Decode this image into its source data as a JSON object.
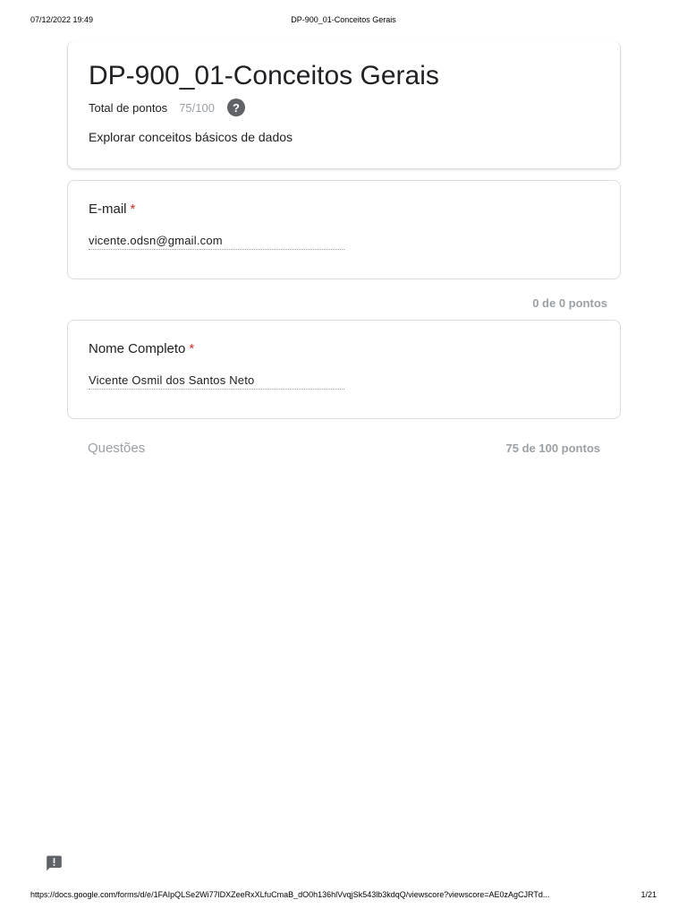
{
  "print_header": {
    "date": "07/12/2022 19:49",
    "title": "DP-900_01-Conceitos Gerais"
  },
  "form": {
    "title": "DP-900_01-Conceitos Gerais",
    "points_label": "Total de pontos",
    "points_value": "75/100",
    "help_icon_glyph": "?",
    "description": "Explorar conceitos básicos de dados"
  },
  "email_question": {
    "label": "E-mail",
    "required_mark": "*",
    "answer": "vicente.odsn@gmail.com",
    "points_note": "0 de 0 pontos"
  },
  "name_question": {
    "label": "Nome Completo",
    "required_mark": "*",
    "answer": "Vicente Osmil dos Santos Neto"
  },
  "questions_section": {
    "title": "Questões",
    "points": "75 de 100 pontos"
  },
  "icons": {
    "help": "help-circle-icon",
    "feedback": "feedback-icon"
  },
  "colors": {
    "required": "#d93025",
    "muted": "#9aa0a6",
    "icon": "#5f6368"
  },
  "print_footer": {
    "url": "https://docs.google.com/forms/d/e/1FAIpQLSe2Wi77lDXZeeRxXLfuCmaB_dO0h136hlVvqjSk543lb3kdqQ/viewscore?viewscore=AE0zAgCJRTd...",
    "page": "1/21"
  }
}
